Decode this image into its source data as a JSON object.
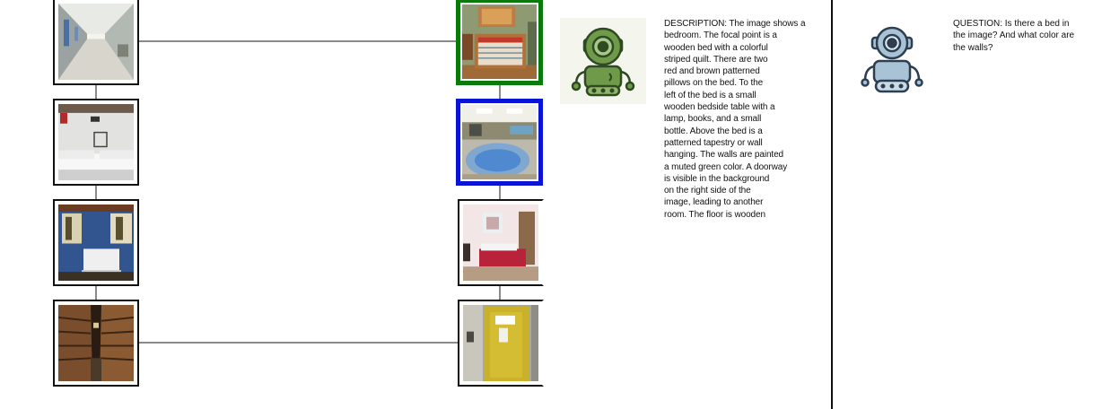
{
  "description_text": "DESCRIPTION: The image shows a\nbedroom. The focal point is a\nwooden bed with a colorful\nstriped quilt. There are two\nred and brown patterned\npillows on the bed. To the\nleft of the bed is a small\nwooden bedside table with a\nlamp, books, and a small\nbottle. Above the bed is a\npatterned tapestry or wall\nhanging. The walls are painted\na muted green color. A doorway\nis visible in the background\non the right side of the\nimage, leading to another\nroom. The floor is wooden",
  "question_text": "QUESTION: Is there a bed in\nthe image? And what color are\nthe walls?",
  "colors": {
    "selected_border": "#0a7a0a",
    "highlight_border": "#0a14d6",
    "default_border": "#111111",
    "connector": "#8a8a8a",
    "robot_green": "#6f9a4a",
    "robot_blue": "#a9c3d6"
  },
  "thumbnails": {
    "left": [
      "hallway-photo",
      "hotel-bedroom-photo",
      "blue-wall-bedroom-photo",
      "archive-shelves-photo"
    ],
    "right": [
      "striped-quilt-bedroom-photo",
      "hot-tub-room-photo",
      "pink-bedroom-photo",
      "yellow-door-photo"
    ]
  },
  "icons": {
    "describer": "green-robot-icon",
    "questioner": "blue-robot-icon"
  }
}
